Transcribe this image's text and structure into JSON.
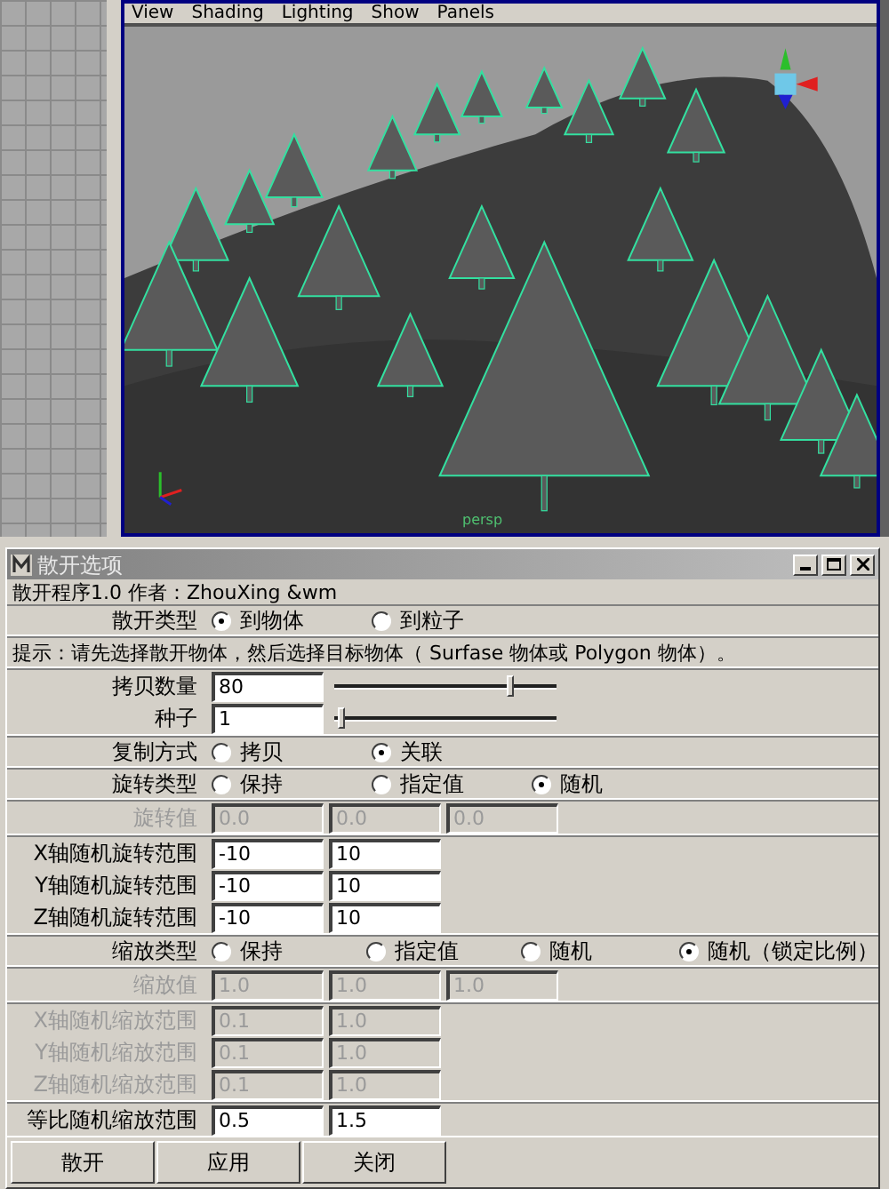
{
  "viewport": {
    "menu": [
      "View",
      "Shading",
      "Lighting",
      "Show",
      "Panels"
    ],
    "camera_label": "persp"
  },
  "dialog": {
    "title": "散开选项",
    "author": "散开程序1.0 作者：ZhouXing &wm",
    "sections": [
      [
        {
          "kind": "radio",
          "label": "散开类型",
          "options": [
            {
              "label": "到物体",
              "selected": true
            },
            {
              "label": "到粒子",
              "selected": false
            }
          ]
        }
      ],
      [
        {
          "kind": "note",
          "text": "提示：请先选择散开物体，然后选择目标物体（ Surfase 物体或 Polygon 物体）。"
        }
      ],
      [
        {
          "kind": "slider",
          "label": "拷贝数量",
          "value": "80",
          "level": 0.8
        },
        {
          "kind": "slider",
          "label": "种子",
          "value": "1",
          "level": 0.02
        }
      ],
      [
        {
          "kind": "radio",
          "label": "复制方式",
          "options": [
            {
              "label": "拷贝",
              "selected": false
            },
            {
              "label": "关联",
              "selected": true
            }
          ]
        }
      ],
      [
        {
          "kind": "radio",
          "label": "旋转类型",
          "options": [
            {
              "label": "保持",
              "selected": false
            },
            {
              "label": "指定值",
              "selected": false
            },
            {
              "label": "随机",
              "selected": true
            }
          ]
        }
      ],
      [
        {
          "kind": "fields",
          "label": "旋转值",
          "disabled": true,
          "values": [
            "0.0",
            "0.0",
            "0.0"
          ]
        }
      ],
      [
        {
          "kind": "fields",
          "label": "X轴随机旋转范围",
          "disabled": false,
          "values": [
            "-10",
            "10"
          ]
        },
        {
          "kind": "fields",
          "label": "Y轴随机旋转范围",
          "disabled": false,
          "values": [
            "-10",
            "10"
          ]
        },
        {
          "kind": "fields",
          "label": "Z轴随机旋转范围",
          "disabled": false,
          "values": [
            "-10",
            "10"
          ]
        }
      ],
      [
        {
          "kind": "radio",
          "label": "缩放类型",
          "options": [
            {
              "label": "保持",
              "selected": false
            },
            {
              "label": "指定值",
              "selected": false
            },
            {
              "label": "随机",
              "selected": false
            },
            {
              "label": "随机（锁定比例）",
              "selected": true
            }
          ]
        }
      ],
      [
        {
          "kind": "fields",
          "label": "缩放值",
          "disabled": true,
          "values": [
            "1.0",
            "1.0",
            "1.0"
          ]
        }
      ],
      [
        {
          "kind": "fields",
          "label": "X轴随机缩放范围",
          "disabled": true,
          "values": [
            "0.1",
            "1.0"
          ]
        },
        {
          "kind": "fields",
          "label": "Y轴随机缩放范围",
          "disabled": true,
          "values": [
            "0.1",
            "1.0"
          ]
        },
        {
          "kind": "fields",
          "label": "Z轴随机缩放范围",
          "disabled": true,
          "values": [
            "0.1",
            "1.0"
          ]
        }
      ],
      [
        {
          "kind": "fields",
          "label": "等比随机缩放范围",
          "disabled": false,
          "values": [
            "0.5",
            "1.5"
          ]
        }
      ]
    ],
    "buttons": [
      "散开",
      "应用",
      "关闭"
    ]
  }
}
